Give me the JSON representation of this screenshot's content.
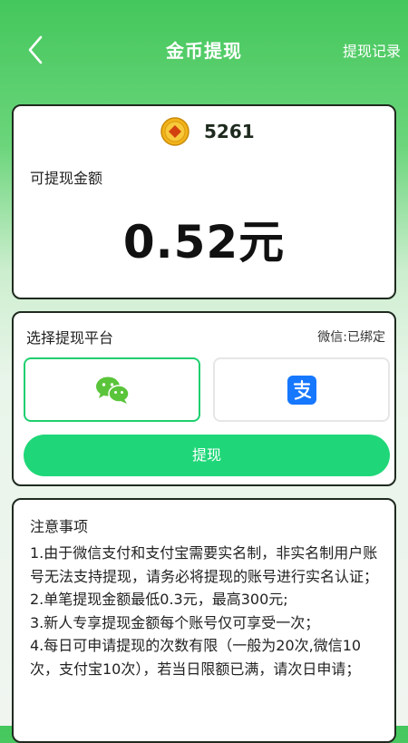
{
  "header": {
    "title": "金币提现",
    "record_label": "提现记录"
  },
  "balance": {
    "coins": "5261",
    "label": "可提现金额",
    "amount": "0.52元"
  },
  "platform": {
    "label": "选择提现平台",
    "bind_status": "微信:已绑定",
    "options": [
      {
        "icon": "wechat-icon",
        "selected": true
      },
      {
        "icon": "alipay-icon",
        "selected": false
      }
    ],
    "withdraw_label": "提现"
  },
  "notes": {
    "title": "注意事项",
    "items": [
      "1.由于微信支付和支付宝需要实名制，非实名制用户账号无法支持提现，请务必将提现的账号进行实名认证；",
      "2.单笔提现金额最低0.3元，最高300元;",
      "3.新人专享提现金额每个账号仅可享受一次；",
      "4.每日可申请提现的次数有限（一般为20次,微信10次，支付宝10次），若当日限额已满，请次日申请；"
    ]
  },
  "colors": {
    "header_green": "#44c75c",
    "button_green": "#1fd778",
    "selected_border": "#1fcf6e",
    "alipay_blue": "#1677ff",
    "coin_gold": "#f2b319"
  }
}
